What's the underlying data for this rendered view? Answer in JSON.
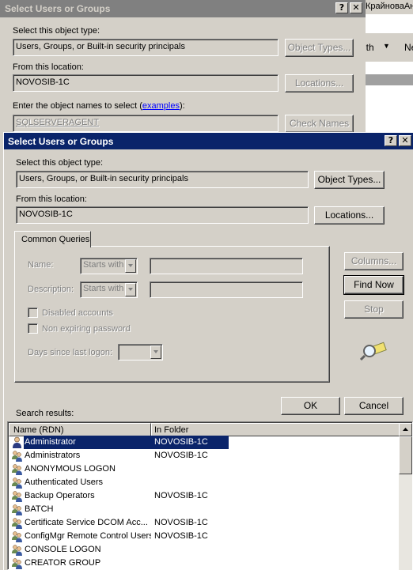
{
  "back_dialog": {
    "title": "Select Users or Groups",
    "object_type_label": "Select this object type:",
    "object_type_value": "Users, Groups, or Built-in security principals",
    "object_types_button": "Object Types...",
    "location_label": "From this location:",
    "location_value": "NOVOSIB-1C",
    "locations_button": "Locations...",
    "names_label_prefix": "Enter the object names to select (",
    "names_label_link": "examples",
    "names_label_suffix": "):",
    "names_value": "SQLSERVERAGENT",
    "check_names_button": "Check Names"
  },
  "background_window": {
    "title_fragment": "КрайноваАн",
    "menu_fragment": "ith",
    "menu_fragment2": "Ne"
  },
  "dialog": {
    "title": "Select Users or Groups",
    "help_button": "?",
    "close_button": "✕",
    "object_type_label": "Select this object type:",
    "object_type_value": "Users, Groups, or Built-in security principals",
    "object_types_button": "Object Types...",
    "location_label": "From this location:",
    "location_value": "NOVOSIB-1C",
    "locations_button": "Locations...",
    "tab_common_queries": "Common Queries",
    "name_label": "Name:",
    "name_operator": "Starts with",
    "description_label": "Description:",
    "description_operator": "Starts with",
    "disabled_accounts": "Disabled accounts",
    "non_expiring_password": "Non expiring password",
    "days_since_logon": "Days since last logon:",
    "columns_button": "Columns...",
    "find_now_button": "Find Now",
    "stop_button": "Stop",
    "ok_button": "OK",
    "cancel_button": "Cancel",
    "search_results_label": "Search results:",
    "columns": [
      "Name (RDN)",
      "In Folder"
    ],
    "results": [
      {
        "name": "Administrator",
        "folder": "NOVOSIB-1C",
        "icon": "user-icon"
      },
      {
        "name": "Administrators",
        "folder": "NOVOSIB-1C",
        "icon": "group-icon"
      },
      {
        "name": "ANONYMOUS LOGON",
        "folder": "",
        "icon": "group-icon"
      },
      {
        "name": "Authenticated Users",
        "folder": "",
        "icon": "group-icon"
      },
      {
        "name": "Backup Operators",
        "folder": "NOVOSIB-1C",
        "icon": "group-icon"
      },
      {
        "name": "BATCH",
        "folder": "",
        "icon": "group-icon"
      },
      {
        "name": "Certificate Service DCOM Acc...",
        "folder": "NOVOSIB-1C",
        "icon": "group-icon"
      },
      {
        "name": "ConfigMgr Remote Control Users",
        "folder": "NOVOSIB-1C",
        "icon": "group-icon"
      },
      {
        "name": "CONSOLE LOGON",
        "folder": "",
        "icon": "group-icon"
      },
      {
        "name": "CREATOR GROUP",
        "folder": "",
        "icon": "group-icon"
      }
    ]
  }
}
